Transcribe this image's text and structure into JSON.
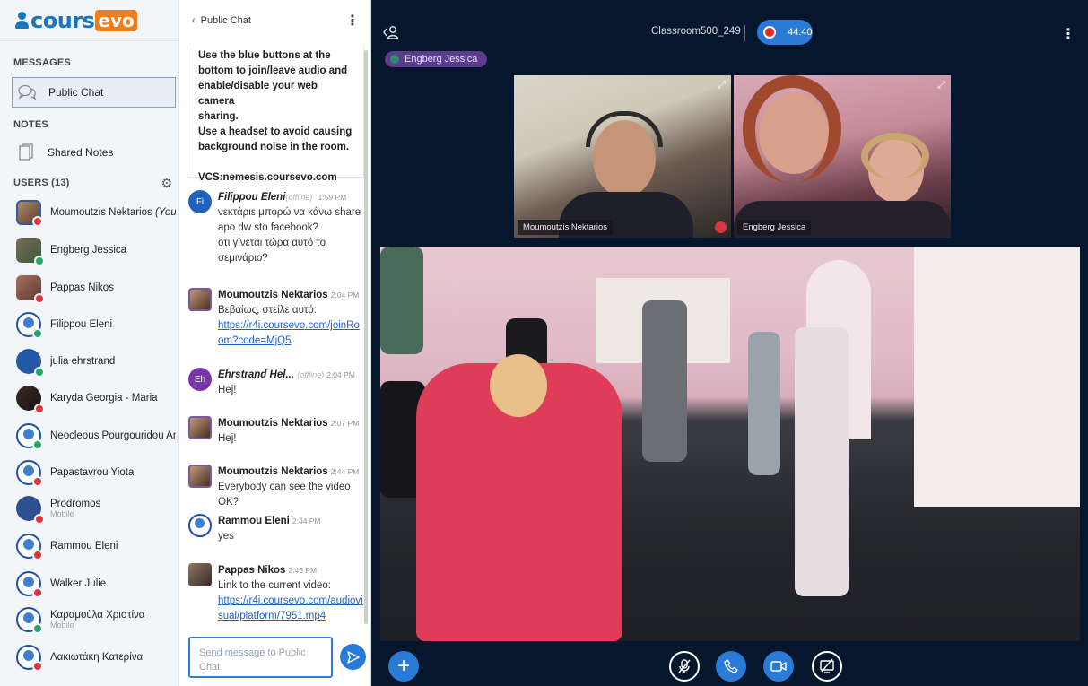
{
  "brand": {
    "part1": "cours",
    "part2": "evo"
  },
  "sidebar": {
    "messages_title": "MESSAGES",
    "public_chat": "Public Chat",
    "notes_title": "NOTES",
    "shared_notes": "Shared Notes",
    "users_title": "USERS (13)",
    "users": [
      {
        "name": "Moumoutzis Nektarios",
        "you": "(You)",
        "sub": ""
      },
      {
        "name": "Engberg Jessica",
        "sub": ""
      },
      {
        "name": "Pappas Nikos",
        "sub": ""
      },
      {
        "name": "Filippou Eleni",
        "sub": ""
      },
      {
        "name": "julia ehrstrand",
        "sub": ""
      },
      {
        "name": "Karyda Georgia - Maria",
        "sub": ""
      },
      {
        "name": "Neocleous Pourgouridou An...",
        "sub": ""
      },
      {
        "name": "Papastavrou Yiota",
        "sub": ""
      },
      {
        "name": "Prodromos",
        "sub": "Mobile"
      },
      {
        "name": "Rammou Eleni",
        "sub": ""
      },
      {
        "name": "Walker Julie",
        "sub": ""
      },
      {
        "name": "Καραμούλα Χριστίνα",
        "sub": "Mobile"
      },
      {
        "name": "Λακιωτάκη Κατερίνα",
        "sub": ""
      }
    ]
  },
  "chat": {
    "title": "Public Chat",
    "welcome_lines": [
      "Use the blue buttons at the",
      "bottom to join/leave audio and",
      "enable/disable your web camera",
      "sharing.",
      "Use a headset to avoid causing",
      "background noise in the room."
    ],
    "welcome_vcs": "VCS:nemesis.coursevo.com",
    "messages": [
      {
        "initials": "Fi",
        "author": "Filippou Eleni",
        "offline": "(offline)",
        "time": "1:59 PM",
        "lines": [
          "νεκτάριε μπορώ να κάνω share",
          "apo dw sto facebook?",
          "οτι γίνεται τώρα αυτό το",
          "σεμινάριο?"
        ]
      },
      {
        "author": "Moumoutzis Nektarios",
        "time": "2:04 PM",
        "lines": [
          "Βεβαίως, στείλε αυτό:"
        ],
        "link_lines": [
          "https://r4i.coursevo.com/joinRo",
          "om?code=MjQ5"
        ]
      },
      {
        "initials": "Eh",
        "author": "Ehrstrand Hel...",
        "offline": "(offline)",
        "time": "2:04 PM",
        "lines": [
          "Hej!"
        ]
      },
      {
        "author": "Moumoutzis Nektarios",
        "time": "2:07 PM",
        "lines": [
          "Hej!"
        ]
      },
      {
        "author": "Moumoutzis Nektarios",
        "time": "2:44 PM",
        "lines": [
          "Everybody can see the video OK?"
        ]
      },
      {
        "author": "Rammou Eleni",
        "time": "2:44 PM",
        "lines": [
          "yes"
        ]
      },
      {
        "author": "Pappas Nikos",
        "time": "2:46 PM",
        "lines": [
          "Link to the current video:"
        ],
        "link_lines": [
          "https://r4i.coursevo.com/audiovi",
          "sual/platform/7951.mp4"
        ]
      }
    ],
    "composer_placeholder_1": "Send message to Public",
    "composer_placeholder_2": "Chat"
  },
  "main": {
    "room_name": "Classroom500_249",
    "recording_time": "44:40",
    "talking_indicator": "Engberg Jessica",
    "webcams": [
      {
        "name": "Moumoutzis Nektarios"
      },
      {
        "name": "Engberg Jessica"
      }
    ]
  },
  "colors": {
    "accent": "#2a7ad8",
    "brand_blue": "#1b75bb",
    "brand_orange": "#f07d1a",
    "main_bg": "#06172d",
    "status_red": "#d9373b",
    "status_green": "#27a56a"
  }
}
